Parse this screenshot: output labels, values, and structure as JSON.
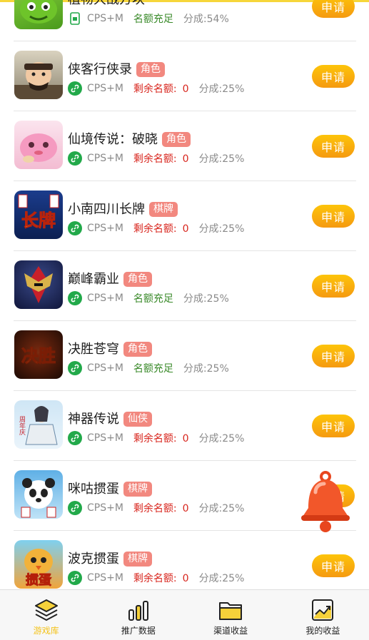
{
  "games": [
    {
      "name": "植物大战方块",
      "tag": "",
      "channel_icon": "phone-icon",
      "mode": "CPS+M",
      "quota": "名额充足",
      "quota_value": "",
      "quota_style": "green",
      "share": "分成:54%",
      "apply_label": "申请"
    },
    {
      "name": "侠客行侠录",
      "tag": "角色",
      "channel_icon": "link-icon",
      "mode": "CPS+M",
      "quota": "剩余名额:",
      "quota_value": "0",
      "quota_style": "red",
      "share": "分成:25%",
      "apply_label": "申请"
    },
    {
      "name": "仙境传说：破晓",
      "tag": "角色",
      "channel_icon": "link-icon",
      "mode": "CPS+M",
      "quota": "剩余名额:",
      "quota_value": "0",
      "quota_style": "red",
      "share": "分成:25%",
      "apply_label": "申请"
    },
    {
      "name": "小南四川长牌",
      "tag": "棋牌",
      "channel_icon": "link-icon",
      "mode": "CPS+M",
      "quota": "剩余名额:",
      "quota_value": "0",
      "quota_style": "red",
      "share": "分成:25%",
      "apply_label": "申请"
    },
    {
      "name": "巅峰霸业",
      "tag": "角色",
      "channel_icon": "link-icon",
      "mode": "CPS+M",
      "quota": "名额充足",
      "quota_value": "",
      "quota_style": "green",
      "share": "分成:25%",
      "apply_label": "申请"
    },
    {
      "name": "决胜苍穹",
      "tag": "角色",
      "channel_icon": "link-icon",
      "mode": "CPS+M",
      "quota": "名额充足",
      "quota_value": "",
      "quota_style": "green",
      "share": "分成:25%",
      "apply_label": "申请"
    },
    {
      "name": "神器传说",
      "tag": "仙侠",
      "channel_icon": "link-icon",
      "mode": "CPS+M",
      "quota": "剩余名额:",
      "quota_value": "0",
      "quota_style": "red",
      "share": "分成:25%",
      "apply_label": "申请"
    },
    {
      "name": "咪咕掼蛋",
      "tag": "棋牌",
      "channel_icon": "link-icon",
      "mode": "CPS+M",
      "quota": "剩余名额:",
      "quota_value": "0",
      "quota_style": "red",
      "share": "分成:25%",
      "apply_label": "申请"
    },
    {
      "name": "波克掼蛋",
      "tag": "棋牌",
      "channel_icon": "link-icon",
      "mode": "CPS+M",
      "quota": "剩余名额:",
      "quota_value": "0",
      "quota_style": "red",
      "share": "分成:25%",
      "apply_label": "申请"
    }
  ],
  "thumb_texts": {
    "changpai": "长牌",
    "juesheng": "决胜",
    "zhounian": "周年庆",
    "guandan": "掼蛋"
  },
  "tabbar": {
    "tabs": [
      {
        "label": "游戏库",
        "icon": "layers-icon",
        "active": true
      },
      {
        "label": "推广数据",
        "icon": "bar-chart-icon",
        "active": false
      },
      {
        "label": "渠道收益",
        "icon": "folder-icon",
        "active": false
      },
      {
        "label": "我的收益",
        "icon": "trend-chart-icon",
        "active": false
      }
    ]
  },
  "colors": {
    "accent": "#f59a10",
    "tag_bg": "#f2887f",
    "active_tab": "#f4c31b",
    "quota_red": "#d8261e",
    "quota_green": "#3a8a2a",
    "link_green": "#22a94a"
  }
}
